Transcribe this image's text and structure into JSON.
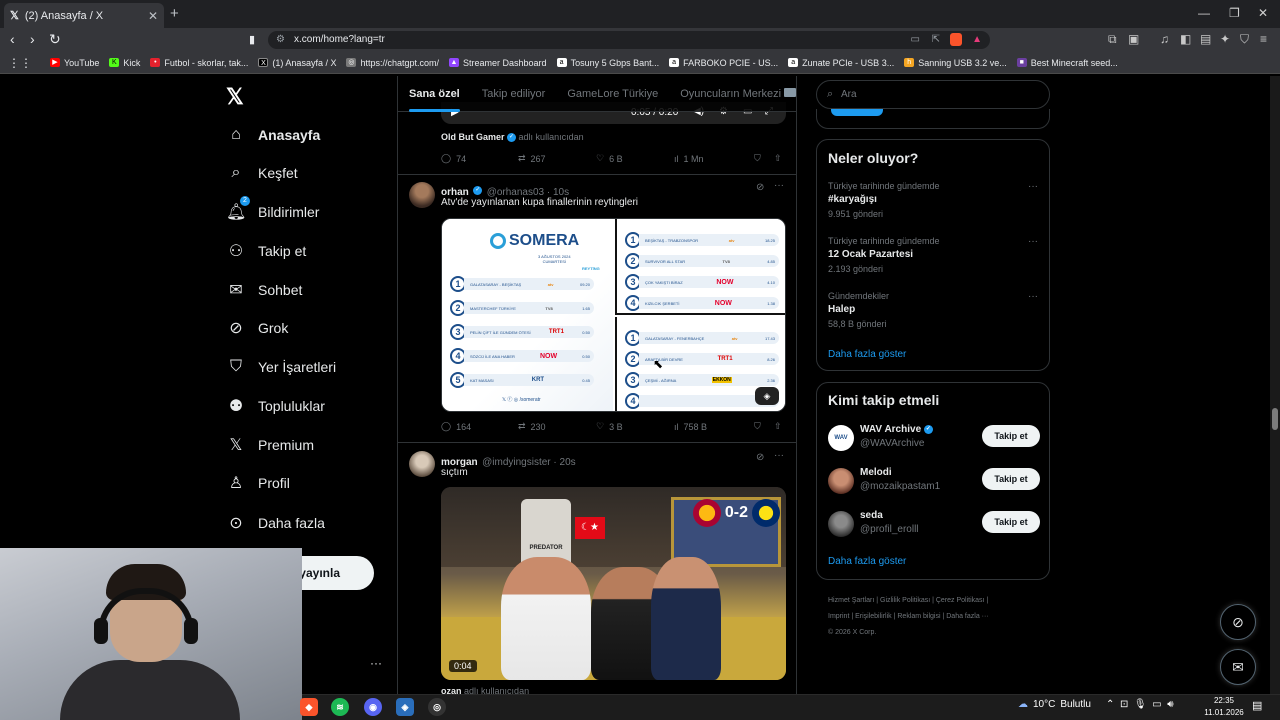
{
  "browser": {
    "tab_title": "(2) Anasayfa / X",
    "tab_close": "✕",
    "new_tab": "+",
    "url": "x.com/home?lang=tr",
    "bookmarks": [
      {
        "label": "YouTube",
        "color": "#ff0000"
      },
      {
        "label": "Kick",
        "color": "#53fc18"
      },
      {
        "label": "Futbol - skorlar, tak...",
        "color": "#e4212d"
      },
      {
        "label": "(1) Anasayfa / X",
        "color": "#000000"
      },
      {
        "label": "https://chatgpt.com/",
        "color": "#7a7a7a"
      },
      {
        "label": "Streamer Dashboard",
        "color": "#9146ff"
      },
      {
        "label": "Tosuny 5 Gbps Bant...",
        "color": "#ffffff"
      },
      {
        "label": "FARBOKO PCIE - US...",
        "color": "#ffffff"
      },
      {
        "label": "Zunate PCIe - USB 3...",
        "color": "#ffffff"
      },
      {
        "label": "Sanning USB 3.2 ve...",
        "color": "#f5a623"
      },
      {
        "label": "Best Minecraft seed...",
        "color": "#6b3fa0"
      }
    ]
  },
  "nav": {
    "items": [
      {
        "label": "Anasayfa",
        "icon": "home-icon"
      },
      {
        "label": "Keşfet",
        "icon": "search-icon"
      },
      {
        "label": "Bildirimler",
        "icon": "bell-icon",
        "badge": "2"
      },
      {
        "label": "Takip et",
        "icon": "person-add-icon"
      },
      {
        "label": "Sohbet",
        "icon": "mail-icon"
      },
      {
        "label": "Grok",
        "icon": "grok-icon"
      },
      {
        "label": "Yer İşaretleri",
        "icon": "bookmark-icon"
      },
      {
        "label": "Topluluklar",
        "icon": "communities-icon"
      },
      {
        "label": "Premium",
        "icon": "x-logo-icon"
      },
      {
        "label": "Profil",
        "icon": "person-icon"
      },
      {
        "label": "Daha fazla",
        "icon": "more-circle-icon"
      }
    ],
    "post_button": "yayınla",
    "account_more": "···"
  },
  "feed": {
    "tabs": [
      "Sana özel",
      "Takip ediliyor",
      "GameLore Türkiye",
      "Oyuncuların Merkezi"
    ],
    "prev_video_time": "0:05 / 0:20",
    "prev_tweet": {
      "reposter": "Old But Gamer",
      "repost_suffix": "adlı kullanıcıdan",
      "replies": "74",
      "reposts": "267",
      "likes": "6 B",
      "views": "1 Mn"
    },
    "tweet1": {
      "name": "orhan",
      "handle": "@orhanas03 · 10s",
      "text": "Atv'de yayınlanan kupa finallerinin reytingleri",
      "replies": "164",
      "reposts": "230",
      "likes": "3 B",
      "views": "758 B",
      "image": {
        "brand": "SOMERA",
        "date_line1": "3 AĞUSTOS 2024",
        "date_line2": "CUMARTESİ",
        "col_header": "REYTİNG",
        "footer": "/someratr",
        "left_rows": [
          {
            "rank": "1",
            "program": "GALATASARAY - BEŞİKTAŞ",
            "channel": "atv",
            "rating": "09.20"
          },
          {
            "rank": "2",
            "program": "MASTERCHEF TÜRKİYE",
            "channel": "TV8",
            "rating": "1.65"
          },
          {
            "rank": "3",
            "program": "PELİN ÇİFT İLE GÜNDEM ÖTESİ",
            "channel": "TRT1",
            "rating": "0.50"
          },
          {
            "rank": "4",
            "program": "SÖZCÜ İLE ANA HABER",
            "channel": "NOW",
            "rating": "0.50"
          },
          {
            "rank": "5",
            "program": "KAT MASASI",
            "channel": "KRT",
            "rating": "0.45"
          }
        ],
        "tr_rows": [
          {
            "rank": "1",
            "program": "BEŞİKTAŞ - TRABZONSPOR",
            "channel": "atv",
            "rating": "18.25"
          },
          {
            "rank": "2",
            "program": "SURVIVOR ALL STAR",
            "channel": "TV8",
            "rating": "4.85"
          },
          {
            "rank": "3",
            "program": "ÇOK YAKIŞTI BİRAZ",
            "channel": "NOW",
            "rating": "4.10"
          },
          {
            "rank": "4",
            "program": "KIZILCIK ŞERBETİ",
            "channel": "NOW",
            "rating": "1.38"
          }
        ],
        "br_rows": [
          {
            "rank": "1",
            "program": "GALATASARAY - FENERBAHÇE",
            "channel": "atv",
            "rating": "17.43"
          },
          {
            "rank": "2",
            "program": "ARAFTA BİR DEVRE",
            "channel": "TRT1",
            "rating": "8.26"
          },
          {
            "rank": "3",
            "program": "ÇEŞMİ - AĞIRNA",
            "channel": "EKKON",
            "rating": "2.36"
          },
          {
            "rank": "4",
            "program": "",
            "channel": "",
            "rating": ""
          }
        ]
      }
    },
    "tweet2": {
      "name": "morgan",
      "handle": "@imdyingsister · 20s",
      "text": "sıçtım",
      "video_time": "0:04",
      "score": "0-2",
      "sponsor": "PREDATOR"
    },
    "next_tweet_name": "ozan",
    "next_tweet_suffix": "adlı kullanıcıdan"
  },
  "sidebar": {
    "search_placeholder": "Ara",
    "trends_title": "Neler oluyor?",
    "trends": [
      {
        "context": "Türkiye tarihinde gündemde",
        "name": "#karyağışı",
        "count": "9.951 gönderi"
      },
      {
        "context": "Türkiye tarihinde gündemde",
        "name": "12 Ocak Pazartesi",
        "count": "2.193 gönderi"
      },
      {
        "context": "Gündemdekiler",
        "name": "Halep",
        "count": "58,8 B gönderi"
      }
    ],
    "trends_more": "Daha fazla göster",
    "who_title": "Kimi takip etmeli",
    "who": [
      {
        "name": "WAV Archive",
        "handle": "@WAVArchive",
        "button": "Takip et",
        "verified": true
      },
      {
        "name": "Melodi",
        "handle": "@mozaikpastam1",
        "button": "Takip et",
        "verified": false
      },
      {
        "name": "seda",
        "handle": "@profil_erolll",
        "button": "Takip et",
        "verified": false
      }
    ],
    "who_more": "Daha fazla göster",
    "footer_line1": "Hizmet Şartları  |  Gizlilik Politikası  |  Çerez Politikası  |",
    "footer_line2": "Imprint  |  Erişilebilirlik  |  Reklam bilgisi  |  Daha fazla ···",
    "copyright": "© 2026 X Corp."
  },
  "taskbar": {
    "temperature": "10°C",
    "weather": "Bulutlu",
    "time": "22:35",
    "date": "11.01.2026"
  }
}
